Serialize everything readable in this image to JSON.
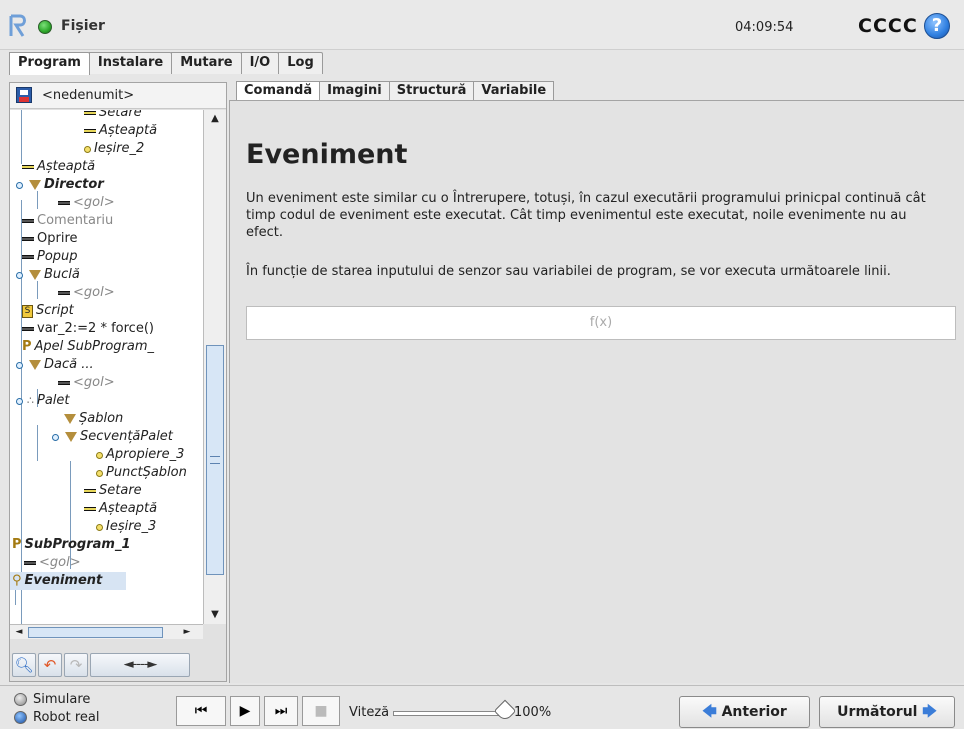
{
  "topbar": {
    "file_label": "Fișier",
    "clock": "04:09:54",
    "robot_name": "CCCC",
    "help_glyph": "?"
  },
  "main_tabs": [
    {
      "label": "Program",
      "active": true
    },
    {
      "label": "Instalare",
      "active": false
    },
    {
      "label": "Mutare",
      "active": false
    },
    {
      "label": "I/O",
      "active": false
    },
    {
      "label": "Log",
      "active": false
    }
  ],
  "program": {
    "name": "<nedenumit>",
    "tree": [
      {
        "label": "Setare",
        "icon": "set-icon"
      },
      {
        "label": "Așteaptă",
        "icon": "wait-icon"
      },
      {
        "label": "Ieșire_2",
        "icon": "waypoint-icon"
      },
      {
        "label": "Așteaptă",
        "icon": "wait-icon"
      },
      {
        "label": "Director",
        "icon": "folder-triangle-icon"
      },
      {
        "label": "<gol>",
        "icon": "empty-icon"
      },
      {
        "label": "Comentariu",
        "icon": "comment-icon"
      },
      {
        "label": "Oprire",
        "icon": "halt-icon"
      },
      {
        "label": "Popup",
        "icon": "popup-icon"
      },
      {
        "label": "Buclă",
        "icon": "loop-triangle-icon"
      },
      {
        "label": "<gol>",
        "icon": "empty-icon"
      },
      {
        "label": "Script",
        "icon": "script-icon"
      },
      {
        "label": "var_2:=2 * force()",
        "icon": "assignment-icon"
      },
      {
        "label": "Apel SubProgram_",
        "icon": "call-icon"
      },
      {
        "label": "Dacă ...",
        "icon": "if-triangle-icon"
      },
      {
        "label": "<gol>",
        "icon": "empty-icon"
      },
      {
        "label": "Palet",
        "icon": "pallet-icon"
      },
      {
        "label": "Șablon",
        "icon": "pattern-triangle-icon"
      },
      {
        "label": "SecvențăPalet",
        "icon": "sequence-triangle-icon"
      },
      {
        "label": "Apropiere_3",
        "icon": "waypoint-icon"
      },
      {
        "label": "PunctȘablon",
        "icon": "waypoint-icon"
      },
      {
        "label": "Setare",
        "icon": "set-icon"
      },
      {
        "label": "Așteaptă",
        "icon": "wait-icon"
      },
      {
        "label": "Ieșire_3",
        "icon": "waypoint-icon"
      },
      {
        "label": "SubProgram_1",
        "icon": "subprogram-icon"
      },
      {
        "label": "<gol>",
        "icon": "empty-icon"
      },
      {
        "label": "Eveniment",
        "icon": "event-icon",
        "selected": true
      }
    ],
    "toolbar": {
      "move_glyph": "◄----►"
    }
  },
  "content_tabs": [
    {
      "label": "Comandă",
      "active": true
    },
    {
      "label": "Imagini",
      "active": false
    },
    {
      "label": "Structură",
      "active": false
    },
    {
      "label": "Variabile",
      "active": false
    }
  ],
  "content": {
    "title": "Eveniment",
    "description_1": "Un eveniment este similar cu o Întrerupere, totuși, în cazul executării programului prinicpal continuă cât timp codul de eveniment este executat. Cât timp evenimentul este executat, noile evenimente nu au efect.",
    "description_2": "În funcție de starea inputului de senzor sau variabilei de program, se vor executa următoarele linii.",
    "expression_placeholder": "f(x)"
  },
  "footer": {
    "mode_simulation": "Simulare",
    "mode_real": "Robot real",
    "speed_label": "Viteză",
    "speed_value": "100%",
    "speed_fraction": 1.0,
    "prev_label": "Anterior",
    "next_label": "Următorul"
  },
  "colors": {
    "accent_blue": "#2f7fe0",
    "status_green": "#2ea82b",
    "selection": "#d7e4f3"
  }
}
